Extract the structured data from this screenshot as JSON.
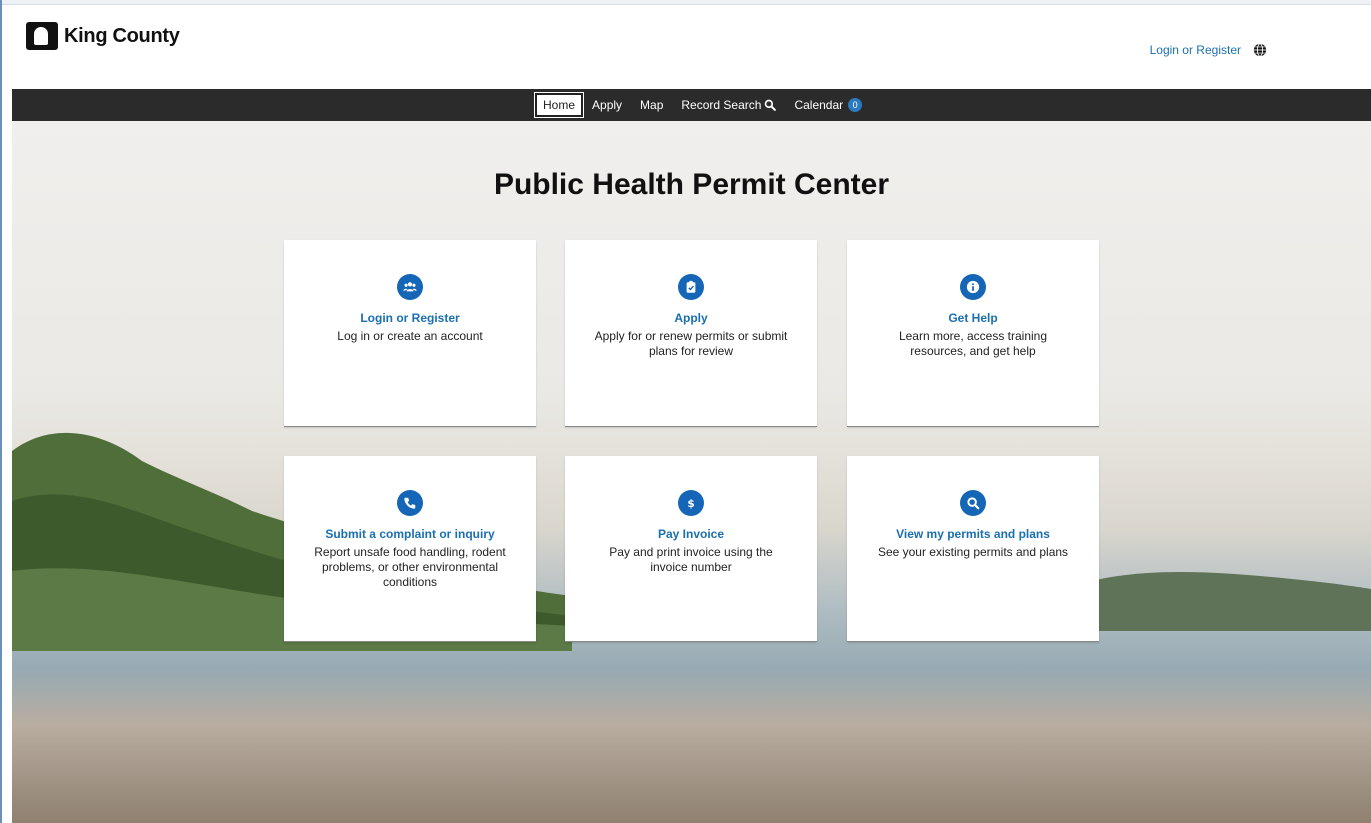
{
  "header": {
    "logo_text": "King County",
    "login_link": "Login or Register"
  },
  "nav": {
    "home": "Home",
    "apply": "Apply",
    "map": "Map",
    "record_search": "Record Search",
    "calendar": "Calendar",
    "calendar_count": "0"
  },
  "main": {
    "title": "Public Health Permit Center",
    "cards": [
      {
        "title": "Login or Register",
        "desc": "Log in or create an account",
        "icon": "users-icon"
      },
      {
        "title": "Apply",
        "desc": "Apply for or renew permits or submit plans for review",
        "icon": "clipboard-check-icon"
      },
      {
        "title": "Get Help",
        "desc": "Learn more, access training resources, and get help",
        "icon": "info-icon"
      },
      {
        "title": "Submit a complaint or inquiry",
        "desc": "Report unsafe food handling, rodent problems, or other environmental conditions",
        "icon": "phone-icon"
      },
      {
        "title": "Pay Invoice",
        "desc": "Pay and print invoice using the invoice number",
        "icon": "dollar-icon"
      },
      {
        "title": "View my permits and plans",
        "desc": "See your existing permits and plans",
        "icon": "search-icon"
      }
    ]
  },
  "colors": {
    "accent": "#1566b7",
    "link": "#1a6fb0",
    "nav_bg": "#2b2b2b"
  }
}
